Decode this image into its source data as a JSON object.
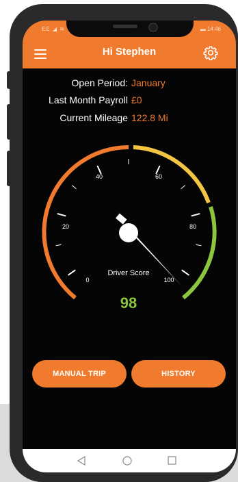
{
  "status_bar": {
    "carrier": "EE",
    "time": "14:46"
  },
  "header": {
    "title": "Hi Stephen",
    "menu_icon": "hamburger-menu-icon",
    "settings_icon": "gear-icon"
  },
  "info": {
    "open_period_label": "Open Period:",
    "open_period_value": "January",
    "payroll_label": "Last Month Payroll",
    "payroll_value": "£0",
    "mileage_label": "Current Mileage",
    "mileage_value": "122.8 Mi"
  },
  "gauge": {
    "label": "Driver Score",
    "score": "98",
    "score_value": 98,
    "min": 0,
    "max": 100,
    "ticks": [
      "0",
      "20",
      "40",
      "60",
      "80",
      "100"
    ]
  },
  "buttons": {
    "manual_trip": "MANUAL TRIP",
    "history": "HISTORY"
  },
  "colors": {
    "accent": "#f07a2e",
    "score_green": "#8cc63f",
    "gauge_yellow": "#f4c542",
    "background": "#050505"
  }
}
